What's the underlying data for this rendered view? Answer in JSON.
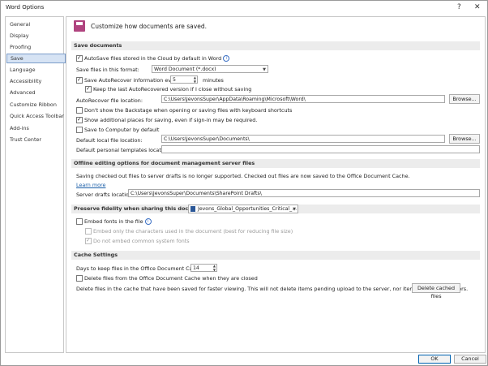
{
  "window": {
    "title": "Word Options",
    "help_icon": "?",
    "close_icon": "✕"
  },
  "sidebar": {
    "items": [
      {
        "label": "General"
      },
      {
        "label": "Display"
      },
      {
        "label": "Proofing"
      },
      {
        "label": "Save"
      },
      {
        "label": "Language"
      },
      {
        "label": "Accessibility"
      },
      {
        "label": "Advanced"
      },
      {
        "label": "Customize Ribbon"
      },
      {
        "label": "Quick Access Toolbar"
      },
      {
        "label": "Add-ins"
      },
      {
        "label": "Trust Center"
      }
    ],
    "selected": "Save"
  },
  "header": {
    "text": "Customize how documents are saved."
  },
  "save_documents": {
    "title": "Save documents",
    "autosave_label": "AutoSave files stored in the Cloud by default in Word",
    "format_label": "Save files in this format:",
    "format_value": "Word Document (*.docx)",
    "autorecover_label": "Save AutoRecover information every",
    "autorecover_minutes": "5",
    "minutes_label": "minutes",
    "keep_last_label": "Keep the last AutoRecovered version if I close without saving",
    "autorecover_location_label": "AutoRecover file location:",
    "autorecover_location_value": "C:\\Users\\JevonsSuper\\AppData\\Roaming\\Microsoft\\Word\\",
    "browse_label": "Browse...",
    "backstage_label": "Don't show the Backstage when opening or saving files with keyboard shortcuts",
    "additional_places_label": "Show additional places for saving, even if sign-in may be required.",
    "save_to_computer_label": "Save to Computer by default",
    "default_local_label": "Default local file location:",
    "default_local_value": "C:\\Users\\JevonsSuper\\Documents\\",
    "browse2_label": "Browse...",
    "templates_label": "Default personal templates location:",
    "templates_value": ""
  },
  "offline": {
    "title": "Offline editing options for document management server files",
    "notice": "Saving checked out files to server drafts is no longer supported. Checked out files are now saved to the Office Document Cache.",
    "learn_more": "Learn more",
    "drafts_label": "Server drafts location:",
    "drafts_value": "C:\\Users\\JevonsSuper\\Documents\\SharePoint Drafts\\"
  },
  "fidelity": {
    "title": "Preserve fidelity when sharing this document:",
    "document_value": "Jevons_Global_Opportunities_Critical_...",
    "embed_fonts_label": "Embed fonts in the file",
    "embed_chars_label": "Embed only the characters used in the document (best for reducing file size)",
    "no_common_label": "Do not embed common system fonts"
  },
  "cache": {
    "title": "Cache Settings",
    "days_label": "Days to keep files in the Office Document Cache:",
    "days_value": "14",
    "delete_closed_label": "Delete files from the Office Document Cache when they are closed",
    "delete_note": "Delete files in the cache that have been saved for faster viewing. This will not delete items pending upload to the server, nor items with upload errors.",
    "delete_button": "Delete cached files"
  },
  "footer": {
    "ok": "OK",
    "cancel": "Cancel"
  },
  "colors": {
    "accent": "#b0447f",
    "selection": "#d6e3f4",
    "link": "#1a5ea8"
  }
}
